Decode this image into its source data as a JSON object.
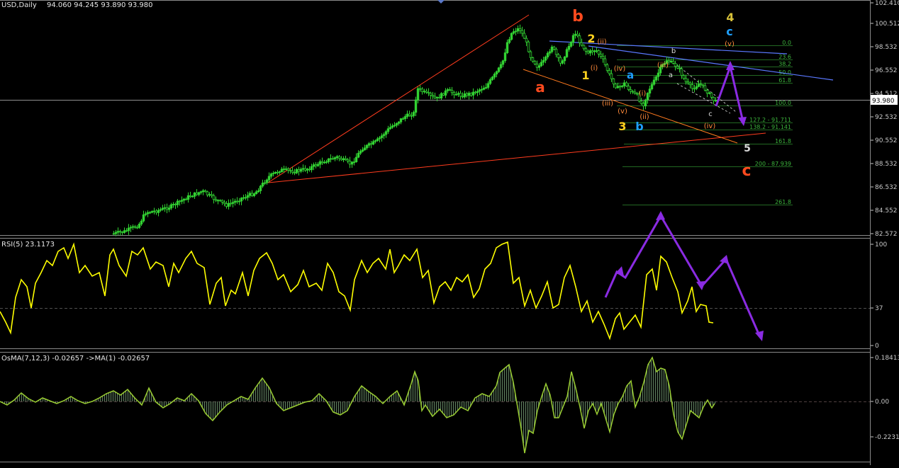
{
  "header": {
    "symbol": "USD,Daily",
    "ohlc": "94.060 94.245 93.890 93.980",
    "rsi_label": "RSI(5) 23.1173",
    "osma_label": "OsMA(7,12,3) -0.02657 ->MA(1) -0.02657"
  },
  "price_axis": {
    "ticks": [
      "102.410",
      "100.512",
      "98.532",
      "96.552",
      "94.512",
      "92.532",
      "90.552",
      "88.532",
      "86.532",
      "84.552",
      "82.572"
    ],
    "current": "93.980"
  },
  "rsi_axis": {
    "ticks": [
      "100",
      "37",
      "0"
    ]
  },
  "osma_axis": {
    "ticks": [
      "0.18413",
      "0.00",
      "-0.22312"
    ]
  },
  "fib_levels": [
    {
      "label": "0.0"
    },
    {
      "label": "23.6"
    },
    {
      "label": "38.2"
    },
    {
      "label": "50.0"
    },
    {
      "label": "61.8"
    },
    {
      "label": "100.0"
    },
    {
      "label": "127.2 - 91.711"
    },
    {
      "label": "138.2 - 91.141"
    },
    {
      "label": "161.8"
    },
    {
      "label": "200 - 87.939"
    },
    {
      "label": "261.8"
    }
  ],
  "wave_labels": [
    {
      "text": "b",
      "color": "#ff4a1e",
      "size": 22
    },
    {
      "text": "a",
      "color": "#ff4a1e",
      "size": 20
    },
    {
      "text": "c",
      "color": "#ff4a1e",
      "size": 22
    },
    {
      "text": "4",
      "color": "#d8c23a",
      "size": 16
    },
    {
      "text": "c",
      "color": "#1ea0ff",
      "size": 16
    },
    {
      "text": "(v)",
      "color": "#ff8a3a",
      "size": 10
    },
    {
      "text": "2",
      "color": "#ffd21e",
      "size": 16
    },
    {
      "text": "1",
      "color": "#ffd21e",
      "size": 16
    },
    {
      "text": "3",
      "color": "#ffd21e",
      "size": 16
    },
    {
      "text": "b",
      "color": "#1ea0ff",
      "size": 16
    },
    {
      "text": "a",
      "color": "#1ea0ff",
      "size": 15
    },
    {
      "text": "5",
      "color": "#d8d8d8",
      "size": 14
    },
    {
      "text": "(ii)",
      "color": "#ff8a3a",
      "size": 10
    },
    {
      "text": "(i)",
      "color": "#ff8a3a",
      "size": 10
    },
    {
      "text": "(iv)",
      "color": "#ff8a3a",
      "size": 10
    },
    {
      "text": "(iii)",
      "color": "#ff8a3a",
      "size": 10
    },
    {
      "text": "(v)",
      "color": "#ff8a3a",
      "size": 10
    },
    {
      "text": "(i)",
      "color": "#ff8a3a",
      "size": 10
    },
    {
      "text": "(ii)",
      "color": "#ff8a3a",
      "size": 10
    },
    {
      "text": "(iii)",
      "color": "#ff8a3a",
      "size": 10
    },
    {
      "text": "b",
      "color": "#dcdcdc",
      "size": 10
    },
    {
      "text": "a",
      "color": "#dcdcdc",
      "size": 10
    },
    {
      "text": "c",
      "color": "#dcdcdc",
      "size": 10
    },
    {
      "text": "(iv)",
      "color": "#ff8a3a",
      "size": 10
    }
  ],
  "colors": {
    "background": "#000000",
    "candles": "#32d232",
    "rsi_line": "#ffff00",
    "osma_line": "#9acd32",
    "osma_histogram": "#5f7f5f",
    "trendline": "#ff3c1e",
    "channel": "#5a78ff",
    "projection": "#8a2be2",
    "fibonacci": "#2e8b2e",
    "grid_line": "#c0c0c0"
  },
  "chart_data": [
    {
      "type": "candlestick",
      "name": "USD,Daily",
      "y_range": [
        82.572,
        102.41
      ],
      "last": {
        "open": 94.06,
        "high": 94.245,
        "low": 93.89,
        "close": 93.98
      },
      "annotations": "Elliott wave labels, Fibonacci extension levels and projected path"
    },
    {
      "type": "line",
      "name": "RSI(5)",
      "current": 23.1173,
      "y_range": [
        0,
        100
      ],
      "reference_level": 37
    },
    {
      "type": "bar",
      "name": "OsMA(7,12,3)",
      "current": -0.02657,
      "y_range": [
        -0.22312,
        0.18413
      ]
    }
  ]
}
